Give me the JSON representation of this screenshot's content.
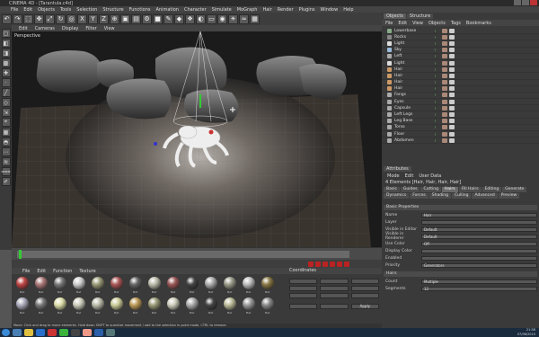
{
  "window": {
    "title": "CINEMA 4D - [Tarantula.c4d]"
  },
  "menubar": {
    "items": [
      "File",
      "Edit",
      "Objects",
      "Tools",
      "Selection",
      "Structure",
      "Functions",
      "Animation",
      "Character",
      "Simulate",
      "MoGraph",
      "Hair",
      "Render",
      "Plugins",
      "Window",
      "Help"
    ]
  },
  "viewport": {
    "menu": [
      "Edit",
      "Cameras",
      "Display",
      "Filter",
      "View"
    ],
    "label": "Perspective"
  },
  "objects": {
    "tabs": [
      "Objects",
      "Structure"
    ],
    "menu": [
      "File",
      "Edit",
      "View",
      "Objects",
      "Tags",
      "Bookmarks"
    ],
    "items": [
      {
        "name": "Lowerbase",
        "color": "#8a8"
      },
      {
        "name": "Rocks",
        "color": "#888"
      },
      {
        "name": "Light",
        "color": "#ddd"
      },
      {
        "name": "Sky",
        "color": "#9bd"
      },
      {
        "name": "Left",
        "color": "#aaa"
      },
      {
        "name": "Light",
        "color": "#ddd"
      },
      {
        "name": "Hair",
        "color": "#c96"
      },
      {
        "name": "Hair",
        "color": "#c96"
      },
      {
        "name": "Hair",
        "color": "#c96"
      },
      {
        "name": "Hair",
        "color": "#c96"
      },
      {
        "name": "Fangs",
        "color": "#aaa"
      },
      {
        "name": "Eyes",
        "color": "#aaa"
      },
      {
        "name": "Capsule",
        "color": "#aaa"
      },
      {
        "name": "Left Legs",
        "color": "#aaa"
      },
      {
        "name": "Leg Base",
        "color": "#aaa"
      },
      {
        "name": "Torso",
        "color": "#aaa"
      },
      {
        "name": "Floor",
        "color": "#aaa"
      },
      {
        "name": "Abdomen",
        "color": "#aaa"
      }
    ]
  },
  "attributes": {
    "title": "Attributes",
    "menu": [
      "Mode",
      "Edit",
      "User Data"
    ],
    "selection": "4 Elements [Hair, Hair, Hair, Hair]",
    "tabs": [
      "Basic",
      "Guides",
      "Cutting",
      "Hairs",
      "Fill Hairs",
      "Editing",
      "Generate",
      "Dynamics",
      "Forces",
      "Shading",
      "Culling",
      "Advanced",
      "Preview"
    ],
    "sections": {
      "basic": "Basic Properties",
      "hairs": "Hairs"
    },
    "rows": [
      {
        "label": "Name",
        "value": "Hair"
      },
      {
        "label": "Layer",
        "value": ""
      },
      {
        "label": "Visible in Editor",
        "value": "Default"
      },
      {
        "label": "Visible in Renderer",
        "value": "Default"
      },
      {
        "label": "Use Color",
        "value": "Off"
      },
      {
        "label": "Display Color",
        "value": ""
      },
      {
        "label": "Enabled",
        "value": ""
      },
      {
        "label": "Priority",
        "value": "Generators"
      }
    ],
    "hairs_rows": [
      {
        "label": "Count",
        "value": "Multiple"
      },
      {
        "label": "Segments",
        "value": "12"
      }
    ]
  },
  "materials": {
    "menu": [
      "File",
      "Edit",
      "Function",
      "Texture"
    ],
    "items": [
      {
        "label": "Mat",
        "color": "#b44"
      },
      {
        "label": "Mat",
        "color": "#a77"
      },
      {
        "label": "Mat",
        "color": "#777"
      },
      {
        "label": "Mat",
        "color": "#ccc"
      },
      {
        "label": "Mat",
        "color": "#997"
      },
      {
        "label": "Mat",
        "color": "#a55"
      },
      {
        "label": "Mat",
        "color": "#666"
      },
      {
        "label": "Mat",
        "color": "#bba"
      },
      {
        "label": "Mat",
        "color": "#955"
      },
      {
        "label": "Mat",
        "color": "#444"
      },
      {
        "label": "Mat",
        "color": "#aaa"
      },
      {
        "label": "Mat",
        "color": "#998"
      },
      {
        "label": "Mat",
        "color": "#bbb"
      },
      {
        "label": "Mat",
        "color": "#874"
      },
      {
        "label": "Mat",
        "color": "#aab"
      },
      {
        "label": "Mat",
        "color": "#777"
      },
      {
        "label": "Mat",
        "color": "#dda"
      },
      {
        "label": "Mat",
        "color": "#ccb"
      },
      {
        "label": "Mat",
        "color": "#bba"
      },
      {
        "label": "Mat",
        "color": "#cc9"
      },
      {
        "label": "Mat",
        "color": "#b95"
      },
      {
        "label": "Mat",
        "color": "#997"
      },
      {
        "label": "Mat",
        "color": "#ccb"
      },
      {
        "label": "Mat",
        "color": "#aaa"
      },
      {
        "label": "Mat",
        "color": "#444"
      },
      {
        "label": "Mat",
        "color": "#bb9"
      },
      {
        "label": "Mat",
        "color": "#999"
      },
      {
        "label": "Mat",
        "color": "#888"
      }
    ]
  },
  "coordinates": {
    "title": "Coordinates",
    "apply": "Apply"
  },
  "status": {
    "text": "Move: Click and drag to move elements. Hold down SHIFT to quantize movement / add to the selection in point mode, CTRL to remove."
  },
  "clock": {
    "time": "21:58",
    "date": "07/06/2010"
  }
}
